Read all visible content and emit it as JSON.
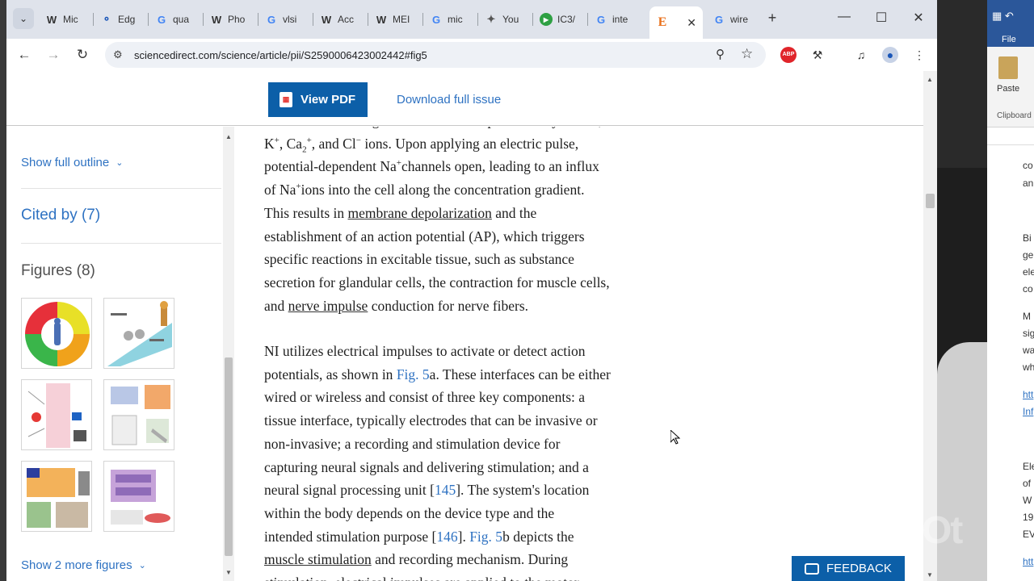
{
  "tabs": [
    {
      "icon": "W",
      "label": "Mic"
    },
    {
      "icon": "Edge",
      "label": "Edg"
    },
    {
      "icon": "G",
      "label": "qua"
    },
    {
      "icon": "W",
      "label": "Pho"
    },
    {
      "icon": "G",
      "label": "vlsi"
    },
    {
      "icon": "W",
      "label": "Acc"
    },
    {
      "icon": "W",
      "label": "MEI"
    },
    {
      "icon": "G",
      "label": "mic"
    },
    {
      "icon": "Yt",
      "label": "You"
    },
    {
      "icon": "IC",
      "label": "IC3/"
    },
    {
      "icon": "G",
      "label": "inte"
    },
    {
      "icon": "E",
      "label": ""
    },
    {
      "icon": "G",
      "label": "wire"
    }
  ],
  "toolbar": {
    "url": "sciencedirect.com/science/article/pii/S2590006423002442#fig5",
    "abp_label": "ABP"
  },
  "header": {
    "view_pdf": "View PDF",
    "download_issue": "Download full issue"
  },
  "sidebar": {
    "show_outline": "Show full outline",
    "cited_by": "Cited by (7)",
    "figures": "Figures (8)",
    "show_more": "Show 2 more figures"
  },
  "article": {
    "p1_partial": "results from a change in the membrane permeability to Na+,",
    "p2": "NI utilizes electrical impulses to activate or detect action"
  },
  "feedback": "FEEDBACK",
  "word": {
    "file": "File",
    "paste": "Paste",
    "clipboard": "Clipboard",
    "snippets": [
      "co",
      "an",
      "Bi",
      "ge",
      "ele",
      "co",
      "M",
      "sig",
      "wa",
      "wh",
      "htt",
      "Inf",
      "Ele",
      "of",
      "W",
      "19",
      "EV",
      "htt"
    ]
  },
  "watermark": "InShOt"
}
